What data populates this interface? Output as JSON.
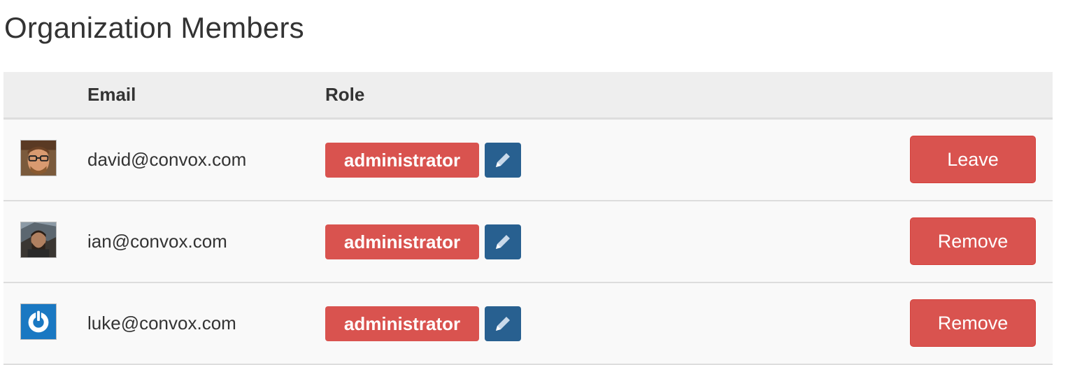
{
  "page": {
    "title": "Organization Members"
  },
  "table": {
    "columns": {
      "avatar": "",
      "email": "Email",
      "role": "Role"
    },
    "rows": [
      {
        "email": "david@convox.com",
        "role": "administrator",
        "action": "Leave",
        "avatar_icon": "photo-avatar-glasses"
      },
      {
        "email": "ian@convox.com",
        "role": "administrator",
        "action": "Remove",
        "avatar_icon": "photo-avatar-dark"
      },
      {
        "email": "luke@convox.com",
        "role": "administrator",
        "action": "Remove",
        "avatar_icon": "power-logo-avatar"
      }
    ]
  },
  "icons": {
    "edit": "pencil-icon"
  },
  "colors": {
    "danger": "#d9534f",
    "primary": "#286090",
    "header_bg": "#eeeeee",
    "row_bg": "#f9f9f9"
  }
}
